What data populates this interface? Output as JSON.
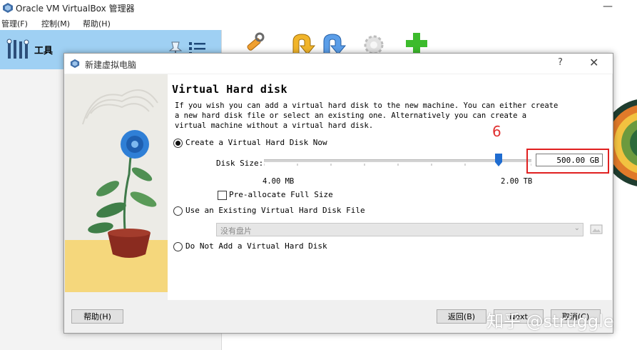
{
  "window": {
    "title": "Oracle VM VirtualBox 管理器",
    "minimize_glyph": "—"
  },
  "menu": [
    "管理(F)",
    "控制(M)",
    "帮助(H)"
  ],
  "sidebar": {
    "tools_label": "工具",
    "icons": [
      "tools-icon",
      "pin-icon",
      "list-icon"
    ],
    "highlight_color": "#9fd0f3"
  },
  "toolbar": {
    "icons": [
      "wrench-icon",
      "import-icon",
      "export-icon",
      "gear-icon",
      "add-icon"
    ]
  },
  "dialog": {
    "title": "新建虚拟电脑",
    "help_glyph": "?",
    "close_glyph": "✕",
    "heading": "Virtual Hard disk",
    "description": "If you wish you can add a virtual hard disk to the new machine. You can either create a new hard disk file or select an existing one. Alternatively you can create a virtual machine without a virtual hard disk.",
    "options": {
      "create": "Create a Virtual Hard Disk Now",
      "existing": "Use an Existing Virtual Hard Disk File",
      "none": "Do Not Add a Virtual Hard Disk",
      "selected": "create"
    },
    "disk_size": {
      "label": "Disk Size:",
      "value": "500.00 GB",
      "min_label": "4.00 MB",
      "max_label": "2.00 TB"
    },
    "preallocate_label": "Pre-allocate Full Size",
    "preallocate_checked": false,
    "existing_select_value": "没有盘片",
    "buttons": {
      "help": "帮助(H)",
      "back": "返回(B)",
      "next": "Next",
      "cancel": "取消(C)"
    }
  },
  "annotation": {
    "step_number": "6",
    "color": "#e02020"
  },
  "watermark": "知乎 @struggle"
}
